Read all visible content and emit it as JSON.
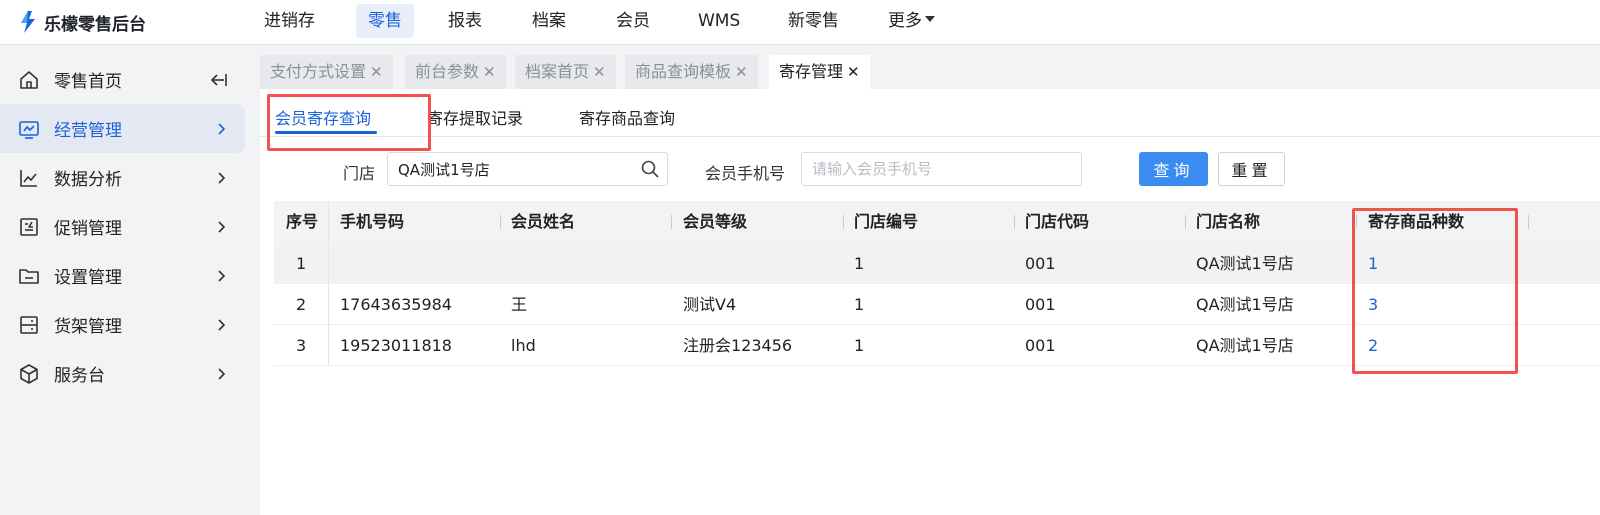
{
  "app": {
    "title": "乐檬零售后台"
  },
  "topnav": {
    "items": [
      {
        "label": "进销存",
        "active": false
      },
      {
        "label": "零售",
        "active": true
      },
      {
        "label": "报表",
        "active": false
      },
      {
        "label": "档案",
        "active": false
      },
      {
        "label": "会员",
        "active": false
      },
      {
        "label": "WMS",
        "active": false
      },
      {
        "label": "新零售",
        "active": false
      },
      {
        "label": "更多",
        "active": false,
        "dropdown": true
      }
    ]
  },
  "sidebar": {
    "items": [
      {
        "label": "零售首页",
        "icon": "home-icon",
        "trailing": "collapse-icon"
      },
      {
        "label": "经营管理",
        "icon": "monitor-chart-icon",
        "trailing": "chevron-right-icon",
        "active": true
      },
      {
        "label": "数据分析",
        "icon": "line-chart-icon",
        "trailing": "chevron-right-icon"
      },
      {
        "label": "促销管理",
        "icon": "promotion-icon",
        "trailing": "chevron-right-icon"
      },
      {
        "label": "设置管理",
        "icon": "folder-icon",
        "trailing": "chevron-right-icon"
      },
      {
        "label": "货架管理",
        "icon": "shelf-icon",
        "trailing": "chevron-right-icon"
      },
      {
        "label": "服务台",
        "icon": "cube-icon",
        "trailing": "chevron-right-icon"
      }
    ]
  },
  "page_tabs": [
    {
      "label": "支付方式设置",
      "close": "✕"
    },
    {
      "label": "前台参数",
      "close": "✕"
    },
    {
      "label": "档案首页",
      "close": "✕"
    },
    {
      "label": "商品查询模板",
      "close": "✕"
    },
    {
      "label": "寄存管理",
      "close": "✕",
      "active": true
    }
  ],
  "sub_tabs": [
    {
      "label": "会员寄存查询",
      "active": true
    },
    {
      "label": "寄存提取记录"
    },
    {
      "label": "寄存商品查询"
    }
  ],
  "filters": {
    "store_label": "门店",
    "store_value": "QA测试1号店",
    "phone_label": "会员手机号",
    "phone_placeholder": "请输入会员手机号",
    "query_button": "查询",
    "reset_button": "重置"
  },
  "table": {
    "columns": [
      "序号",
      "手机号码",
      "会员姓名",
      "会员等级",
      "门店编号",
      "门店代码",
      "门店名称",
      "寄存商品种数"
    ],
    "rows": [
      {
        "index": "1",
        "phone": "",
        "name": "",
        "level": "",
        "store_no": "1",
        "store_code": "001",
        "store_name": "QA测试1号店",
        "item_count": "1"
      },
      {
        "index": "2",
        "phone": "17643635984",
        "name": "王",
        "level": "测试V4",
        "store_no": "1",
        "store_code": "001",
        "store_name": "QA测试1号店",
        "item_count": "3"
      },
      {
        "index": "3",
        "phone": "19523011818",
        "name": "lhd",
        "level": "注册会123456",
        "store_no": "1",
        "store_code": "001",
        "store_name": "QA测试1号店",
        "item_count": "2"
      }
    ]
  },
  "colors": {
    "accent": "#1a62d8",
    "primary_button": "#3b8cf0",
    "highlight_box": "#ef5350",
    "sidebar_bg": "#f2f3f5"
  }
}
